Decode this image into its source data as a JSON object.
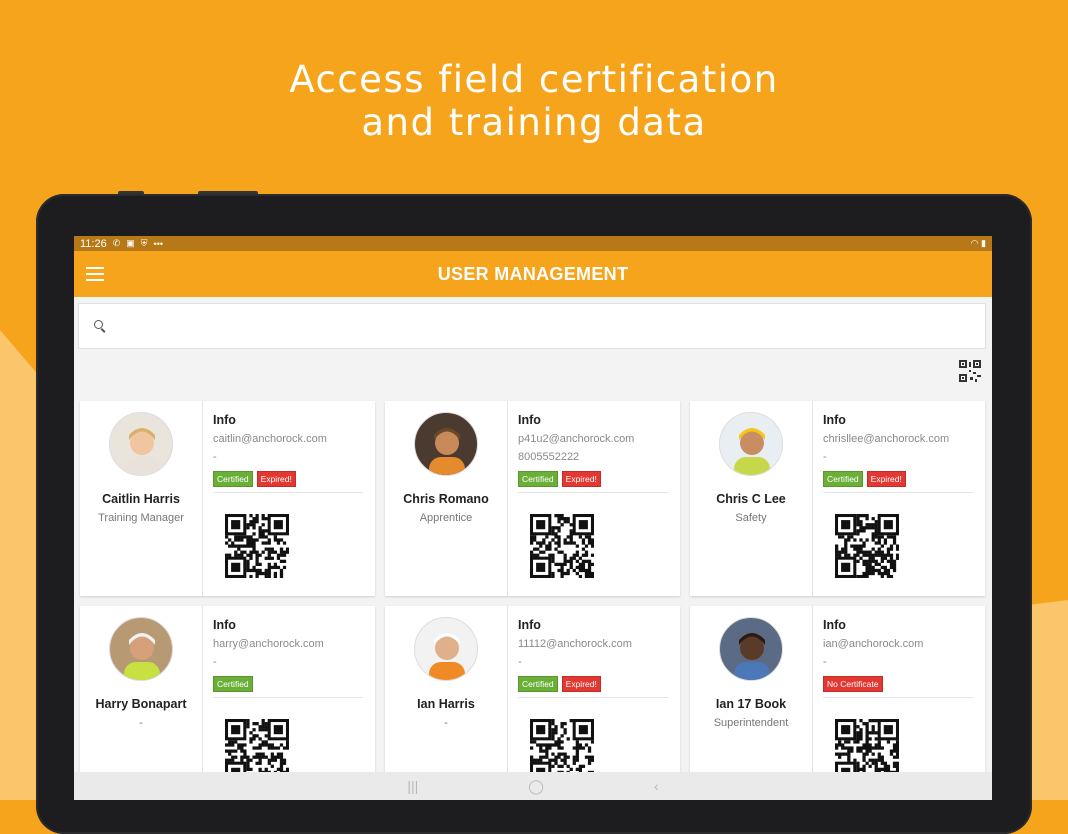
{
  "headline": {
    "line1": "Access field certification",
    "line2": "and training data"
  },
  "status_bar": {
    "time": "11:26",
    "icons": [
      "wifi-calling-icon",
      "image-icon",
      "shield-icon",
      "more-dots-icon"
    ],
    "right_icons": [
      "wifi-icon",
      "battery-icon"
    ]
  },
  "app": {
    "title": "USER MANAGEMENT",
    "search_placeholder": ""
  },
  "users": [
    {
      "name": "Caitlin Harris",
      "role": "Training Manager",
      "info_label": "Info",
      "email": "caitlin@anchorock.com",
      "phone": "-",
      "badges": [
        {
          "label": "Certified",
          "color": "#6AAF38"
        },
        {
          "label": "Expired!",
          "color": "#E33731"
        }
      ]
    },
    {
      "name": "Chris Romano",
      "role": "Apprentice",
      "info_label": "Info",
      "email": "p41u2@anchorock.com",
      "phone": "8005552222",
      "badges": [
        {
          "label": "Certified",
          "color": "#6AAF38"
        },
        {
          "label": "Expired!",
          "color": "#E33731"
        }
      ]
    },
    {
      "name": "Chris C Lee",
      "role": "Safety",
      "info_label": "Info",
      "email": "chrisllee@anchorock.com",
      "phone": "-",
      "badges": [
        {
          "label": "Certified",
          "color": "#6AAF38"
        },
        {
          "label": "Expired!",
          "color": "#E33731"
        }
      ]
    },
    {
      "name": "Harry Bonapart",
      "role": "-",
      "info_label": "Info",
      "email": "harry@anchorock.com",
      "phone": "-",
      "badges": [
        {
          "label": "Certified",
          "color": "#6AAF38"
        }
      ]
    },
    {
      "name": "Ian Harris",
      "role": "-",
      "info_label": "Info",
      "email": "11112@anchorock.com",
      "phone": "-",
      "badges": [
        {
          "label": "Certified",
          "color": "#6AAF38"
        },
        {
          "label": "Expired!",
          "color": "#E33731"
        }
      ]
    },
    {
      "name": "Ian 17 Book",
      "role": "Superintendent",
      "info_label": "Info",
      "email": "ian@anchorock.com",
      "phone": "-",
      "badges": [
        {
          "label": "No Certificate",
          "color": "#E33731"
        }
      ]
    }
  ],
  "colors": {
    "brand_orange": "#F7A41D",
    "certified_green": "#6AAF38",
    "expired_red": "#E33731"
  }
}
